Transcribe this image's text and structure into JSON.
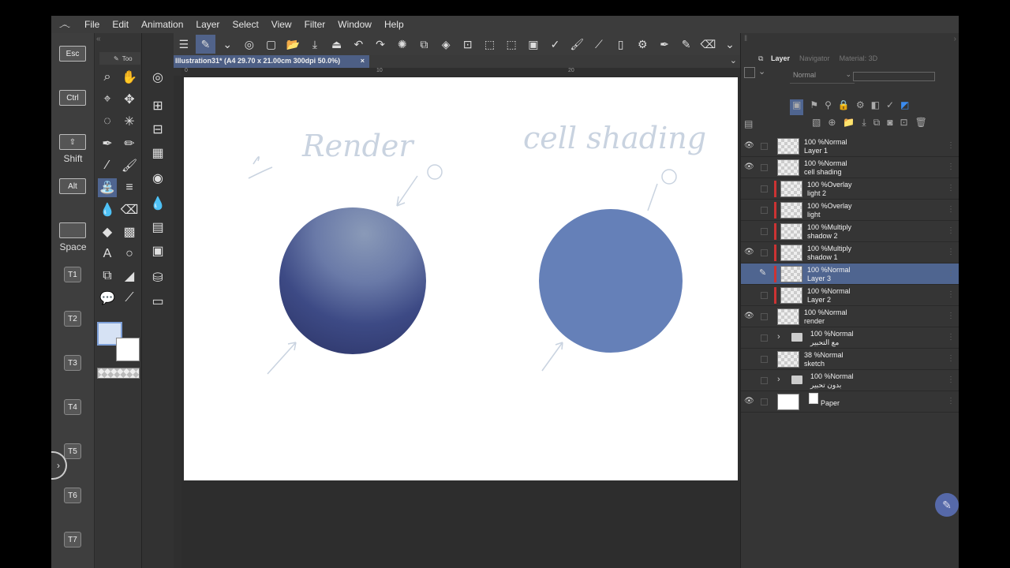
{
  "menu": {
    "items": [
      "File",
      "Edit",
      "Animation",
      "Layer",
      "Select",
      "View",
      "Filter",
      "Window",
      "Help"
    ]
  },
  "keys": {
    "esc": "Esc",
    "ctrl": "Ctrl",
    "shift": "Shift",
    "alt": "Alt",
    "space": "Space",
    "t_keys": [
      "T1",
      "T2",
      "T3",
      "T4",
      "T5",
      "T6",
      "T7"
    ]
  },
  "subtool": {
    "tab_label": "Too"
  },
  "canvas": {
    "tab_title": "Illustration31* (A4 29.70 x 21.00cm 300dpi 50.0%)",
    "ruler_marks": [
      "0",
      "10",
      "20"
    ],
    "sketch_left": "Render",
    "sketch_right": "cell shading"
  },
  "panel": {
    "tabs": [
      "Layer",
      "Navigator",
      "Material: 3D"
    ],
    "blend_mode": "Normal"
  },
  "layers": [
    {
      "mode": "100 %Normal",
      "name": "Layer 1",
      "visible": true,
      "kind": "raster",
      "marker": false,
      "selected": false
    },
    {
      "mode": "100 %Normal",
      "name": "cell shading",
      "visible": true,
      "kind": "raster",
      "marker": false,
      "selected": false
    },
    {
      "mode": "100 %Overlay",
      "name": "light 2",
      "visible": false,
      "kind": "raster",
      "marker": true,
      "selected": false
    },
    {
      "mode": "100 %Overlay",
      "name": "light",
      "visible": false,
      "kind": "raster",
      "marker": true,
      "selected": false
    },
    {
      "mode": "100 %Multiply",
      "name": "shadow 2",
      "visible": false,
      "kind": "raster",
      "marker": true,
      "selected": false
    },
    {
      "mode": "100 %Multiply",
      "name": "shadow 1",
      "visible": true,
      "kind": "raster",
      "marker": true,
      "selected": false
    },
    {
      "mode": "100 %Normal",
      "name": "Layer 3",
      "visible": false,
      "kind": "raster",
      "marker": true,
      "selected": true
    },
    {
      "mode": "100 %Normal",
      "name": "Layer 2",
      "visible": false,
      "kind": "raster",
      "marker": true,
      "selected": false
    },
    {
      "mode": "100 %Normal",
      "name": "render",
      "visible": true,
      "kind": "raster",
      "marker": false,
      "selected": false
    },
    {
      "mode": "100 %Normal",
      "name": "مع التحبير",
      "visible": false,
      "kind": "folder",
      "marker": false,
      "selected": false
    },
    {
      "mode": "38 %Normal",
      "name": "sketch",
      "visible": false,
      "kind": "raster",
      "marker": false,
      "selected": false
    },
    {
      "mode": "100 %Normal",
      "name": "بدون تحبير",
      "visible": false,
      "kind": "folder",
      "marker": false,
      "selected": false
    },
    {
      "mode": "",
      "name": "Paper",
      "visible": true,
      "kind": "paper",
      "marker": false,
      "selected": false
    }
  ],
  "colors": {
    "accent": "#4f6590",
    "main_color": "#d6e2f4",
    "sub_color": "#ffffff",
    "render_ball_light": "#8a9ab8",
    "render_ball_dark": "#2d3568",
    "cell_ball": "#6580b8"
  }
}
